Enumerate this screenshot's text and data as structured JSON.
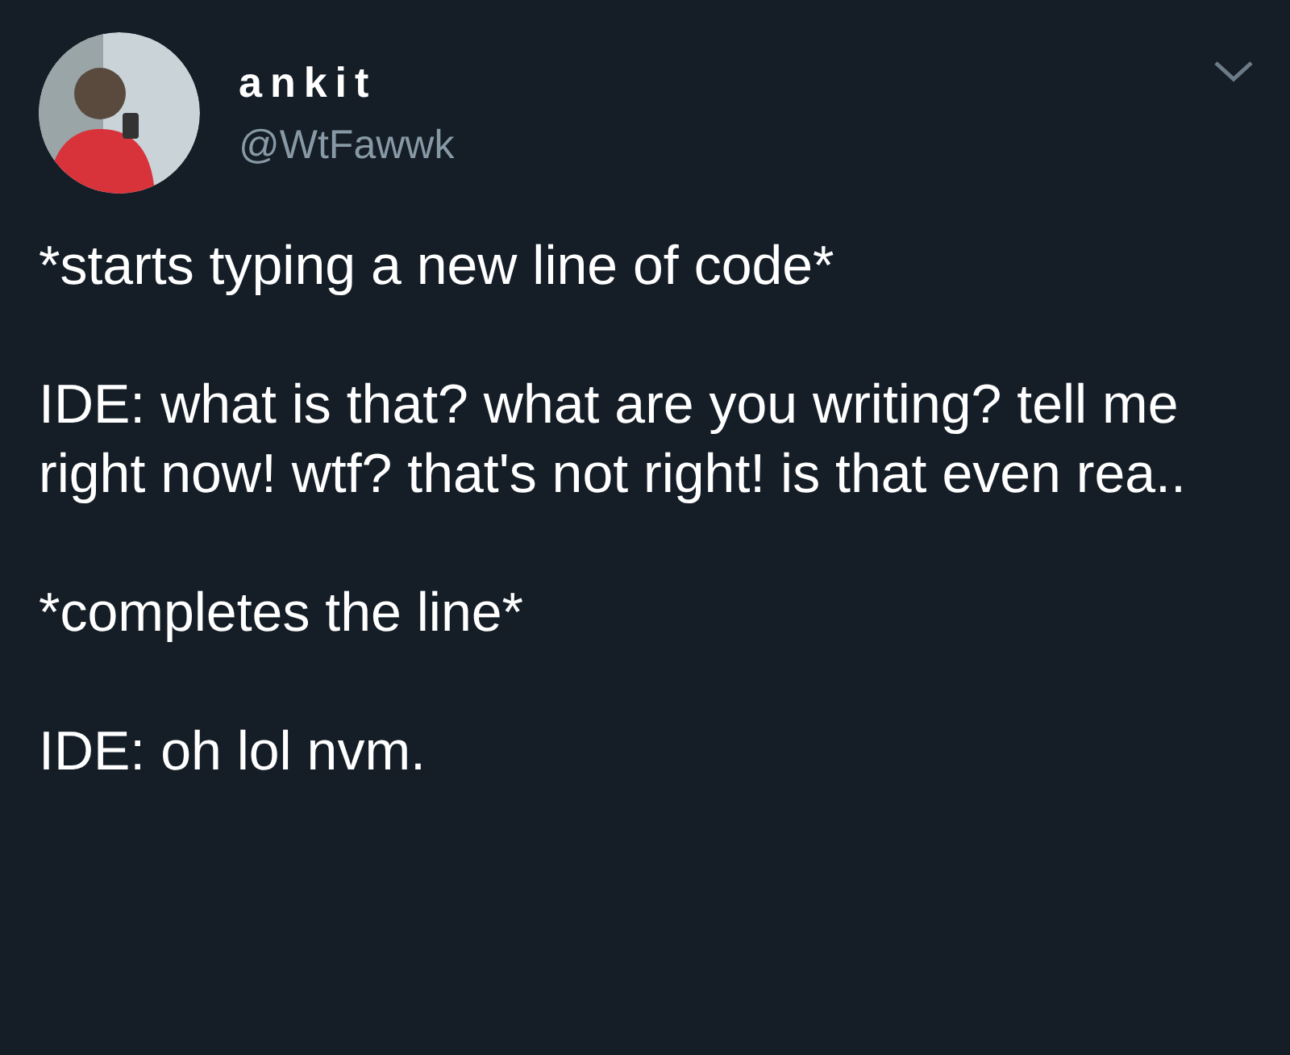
{
  "author": {
    "name": "ankit",
    "handle": "@WtFawwk"
  },
  "paragraphs": [
    "*starts typing a new line of code*",
    "IDE: what is that? what are you writing? tell me right now! wtf? that's not right! is that even rea..",
    "*completes the line*",
    "IDE: oh lol nvm."
  ]
}
